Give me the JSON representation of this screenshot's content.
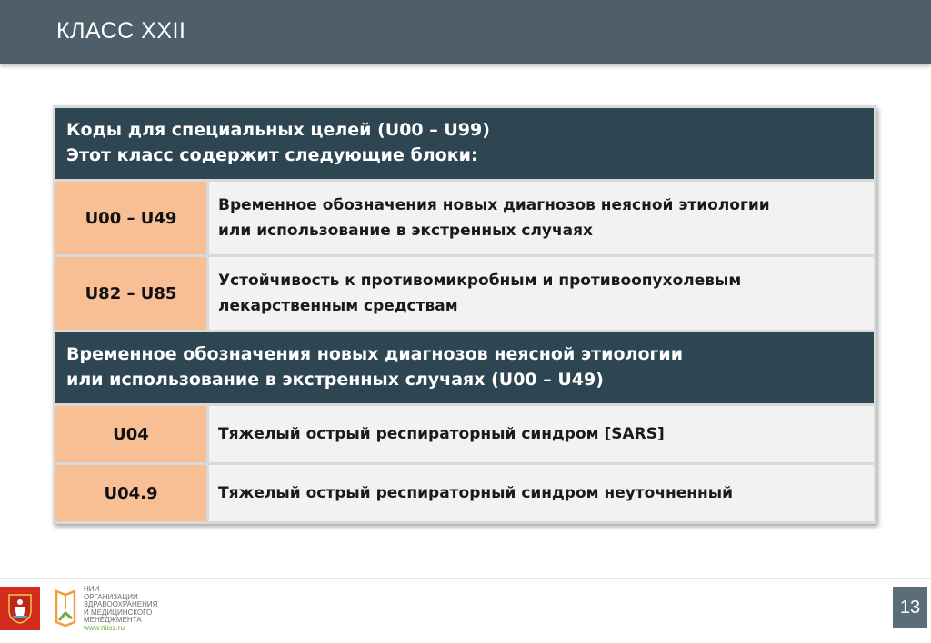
{
  "header": {
    "title": "КЛАСС XXII"
  },
  "table": {
    "section1": {
      "line1": "Коды для специальных целей (U00 – U99)",
      "line2": "Этот класс содержит следующие блоки:"
    },
    "rows1": [
      {
        "code": "U00 – U49",
        "line1": "Временное обозначения новых диагнозов неясной этиологии",
        "line2": "или использование в экстренных случаях"
      },
      {
        "code": "U82 – U85",
        "line1": "Устойчивость к противомикробным и противоопухолевым",
        "line2": "лекарственным средствам"
      }
    ],
    "section2": {
      "line1": "Временное обозначения новых диагнозов неясной этиологии",
      "line2": "или использование в экстренных случаях (U00 – U49)"
    },
    "rows2": [
      {
        "code": "U04",
        "desc": "Тяжелый острый респираторный синдром [SARS]"
      },
      {
        "code": "U04.9",
        "desc": "Тяжелый острый респираторный синдром неуточненный"
      }
    ]
  },
  "footer": {
    "org_lines": [
      "НИИ",
      "ОРГАНИЗАЦИИ",
      "ЗДРАВООХРАНЕНИЯ",
      "И МЕДИЦИНСКОГО",
      "МЕНЕДЖМЕНТА"
    ],
    "org_url": "www.niioz.ru",
    "page_number": "13"
  },
  "colors": {
    "header_bg": "#4e5f6a",
    "section_bg": "#2e4552",
    "code_bg": "#f8bf95",
    "desc_bg": "#f2f2f2",
    "moscow_red": "#d52b1e",
    "logo_green": "#6fae3c",
    "logo_orange": "#f39c3c"
  }
}
